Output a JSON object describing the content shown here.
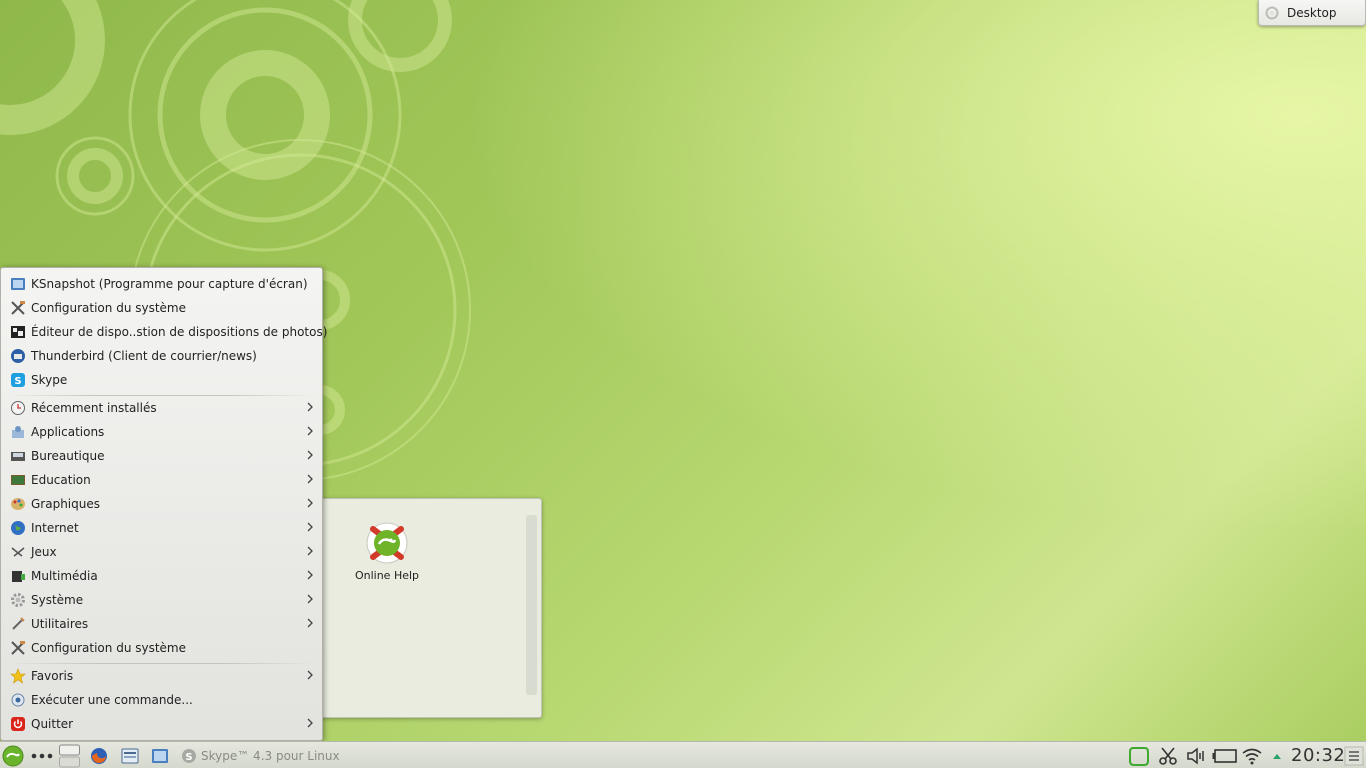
{
  "desktop_toolbox": {
    "label": "Desktop"
  },
  "folder_view": {
    "items": [
      {
        "label": "Online Help"
      }
    ]
  },
  "menu": {
    "favorites_apps": [
      {
        "label": "KSnapshot (Programme pour capture d'écran)",
        "icon": "camera-icon"
      },
      {
        "label": "Configuration du système",
        "icon": "tools-icon"
      },
      {
        "label": "Éditeur de dispo..stion de dispositions de photos)",
        "icon": "photo-layout-icon"
      },
      {
        "label": "Thunderbird (Client de courrier/news)",
        "icon": "thunderbird-icon"
      },
      {
        "label": "Skype",
        "icon": "skype-icon"
      }
    ],
    "categories": [
      {
        "label": "Récemment installés",
        "icon": "clock-icon"
      },
      {
        "label": "Applications",
        "icon": "applications-icon"
      },
      {
        "label": "Bureautique",
        "icon": "office-icon"
      },
      {
        "label": "Education",
        "icon": "education-icon"
      },
      {
        "label": "Graphiques",
        "icon": "graphics-icon"
      },
      {
        "label": "Internet",
        "icon": "globe-icon"
      },
      {
        "label": "Jeux",
        "icon": "games-icon"
      },
      {
        "label": "Multimédia",
        "icon": "multimedia-icon"
      },
      {
        "label": "Système",
        "icon": "system-gear-icon"
      },
      {
        "label": "Utilitaires",
        "icon": "utilities-icon"
      }
    ],
    "system_settings": {
      "label": "Configuration du système",
      "icon": "tools-icon"
    },
    "bottom": [
      {
        "label": "Favoris",
        "icon": "star-icon",
        "submenu": true
      },
      {
        "label": "Exécuter une commande...",
        "icon": "run-command-icon",
        "submenu": false
      },
      {
        "label": "Quitter",
        "icon": "power-icon",
        "submenu": true
      }
    ]
  },
  "taskbar": {
    "task_skype": "Skype™ 4.3 pour Linux",
    "clock": "20:32"
  },
  "colors": {
    "wallpaper_green": "#a3c85a",
    "menu_bg": "#eeeeeb",
    "taskbar_bg": "#dcdfd3"
  }
}
